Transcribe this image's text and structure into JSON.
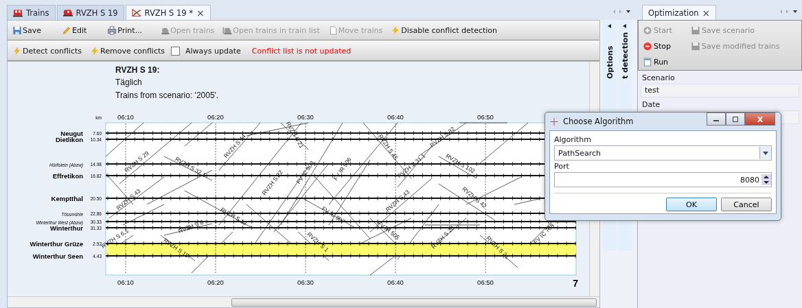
{
  "tabs": [
    {
      "label": "Trains",
      "kind": "trains",
      "selected": false
    },
    {
      "label": "RVZH S 19",
      "kind": "train",
      "selected": false
    },
    {
      "label": "RVZH S 19 *",
      "kind": "graph",
      "selected": true,
      "close": "×"
    }
  ],
  "toolbar": [
    {
      "label": "Save",
      "kind": "save",
      "disabled": false
    },
    {
      "label": "Edit",
      "kind": "edit",
      "disabled": false
    },
    {
      "label": "Print...",
      "kind": "print",
      "disabled": false
    },
    {
      "label": "Open trains",
      "kind": "train",
      "disabled": true
    },
    {
      "label": "Open trains in train list",
      "kind": "train-list",
      "disabled": true
    },
    {
      "label": "Move trains",
      "kind": "page",
      "disabled": true
    },
    {
      "label": "Disable conflict detection",
      "kind": "bolt",
      "disabled": false
    }
  ],
  "conflict_bar": {
    "buttons": [
      {
        "label": "Detect conflicts",
        "kind": "bolt"
      },
      {
        "label": "Remove conflicts",
        "kind": "bolt"
      }
    ],
    "checkbox": {
      "label": "Always update",
      "checked": false
    },
    "status": "Conflict list is not updated"
  },
  "document": {
    "title": "RVZH S 19:",
    "subtitle": "Täglich",
    "note": "Trains from scenario: '2005'.",
    "page_number": "7",
    "graph": {
      "unit": "km",
      "top_times": [
        "06:10",
        "06:20",
        "06:30",
        "06:40",
        "06:50"
      ],
      "bottom_times": [
        "06:10",
        "06:20",
        "06:30",
        "06:40",
        "06:50"
      ],
      "stations": [
        {
          "name": "Neugut",
          "km": "7.60",
          "kind": "major",
          "highlighted": false
        },
        {
          "name": "Dietlikon",
          "km": "10.34",
          "kind": "major",
          "highlighted": false
        },
        {
          "name": "Hürlistein (Abzw)",
          "km": "14.98",
          "kind": "minor",
          "highlighted": false
        },
        {
          "name": "Effretikon",
          "km": "16.82",
          "kind": "major",
          "highlighted": false
        },
        {
          "name": "Kemptthal",
          "km": "20.50",
          "kind": "major",
          "highlighted": false
        },
        {
          "name": "Tössmühle",
          "km": "22.86",
          "kind": "minor",
          "highlighted": false
        },
        {
          "name": "Winterthur West (Abzw)",
          "km": "30.33",
          "kind": "minor",
          "highlighted": false
        },
        {
          "name": "Winterthur",
          "km": "31.33",
          "kind": "major",
          "highlighted": false
        },
        {
          "name": "Winterthur Grüze",
          "km": "2.52",
          "kind": "major",
          "highlighted": true
        },
        {
          "name": "Winterthur Seen",
          "km": "4.43",
          "kind": "major",
          "highlighted": false
        }
      ],
      "trains": [
        "RVZH S 29",
        "RVZH S 32.1",
        "RVZH S 44",
        "RVZH S 21",
        "FV IC 908",
        "FV IR 906",
        "RVZH S 22",
        "RVZH S 43",
        "RVZH S 45",
        "RVZH S 12",
        "FV IC 907",
        "RVZH S 8",
        "RVZH S 19",
        "RVZH S 1",
        "FV IR 505",
        "RVZH S 31.1",
        "RVZH S 102",
        "RVZH S 32",
        "RVZH S 42",
        "RVZH S 20",
        "RVZH S 31",
        "FV IC 708",
        "RVZH S 6.1",
        "RVZH S 43"
      ]
    }
  },
  "side_tabs": [
    "Options",
    "t detection"
  ],
  "optimization": {
    "tab": "Optimization",
    "tab_close": "×",
    "buttons": [
      {
        "label": "Start",
        "kind": "start",
        "disabled": true
      },
      {
        "label": "Save scenario",
        "kind": "save",
        "disabled": true
      },
      {
        "label": "Stop",
        "kind": "stop",
        "disabled": false
      },
      {
        "label": "Save modified trains",
        "kind": "save",
        "disabled": true
      },
      {
        "label": "Run",
        "kind": "run",
        "disabled": false
      }
    ],
    "scenario_label": "Scenario",
    "scenario_value": "test",
    "date_label": "Date"
  },
  "dialog": {
    "title": "Choose Algorithm",
    "algorithm_label": "Algorithm",
    "algorithm_value": "PathSearch",
    "port_label": "Port",
    "port_value": "8080",
    "buttons": [
      {
        "label": "OK",
        "default": true
      },
      {
        "label": "Cancel",
        "default": false
      }
    ]
  }
}
